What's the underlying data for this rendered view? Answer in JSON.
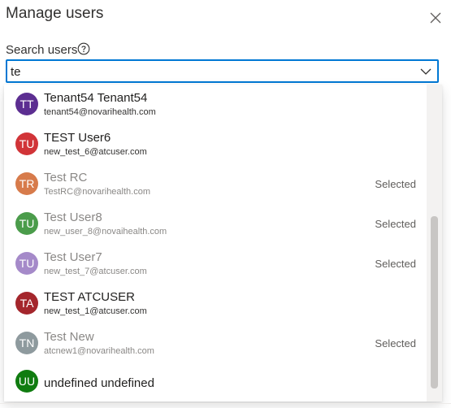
{
  "dialog": {
    "title": "Manage users",
    "close_icon": "close-icon"
  },
  "search": {
    "label": "Search users",
    "help_icon": "question-circle-icon",
    "value": "te",
    "dropdown_icon": "chevron-down-icon"
  },
  "options": [
    {
      "initials": "TT",
      "name": "Tenant54 Tenant54",
      "email": "tenant54@novarihealth.com",
      "color": "#5c2e91",
      "status": ""
    },
    {
      "initials": "TU",
      "name": "TEST User6",
      "email": "new_test_6@atcuser.com",
      "color": "#d13438",
      "status": ""
    },
    {
      "initials": "TR",
      "name": "Test RC",
      "email": "TestRC@novarihealth.com",
      "color": "#ca5010",
      "status": "Selected"
    },
    {
      "initials": "TU",
      "name": "Test User8",
      "email": "new_user_8@novaihealth.com",
      "color": "#107c10",
      "status": "Selected"
    },
    {
      "initials": "TU",
      "name": "Test User7",
      "email": "new_test_7@atcuser.com",
      "color": "#8764b8",
      "status": "Selected"
    },
    {
      "initials": "TA",
      "name": "TEST ATCUSER",
      "email": "new_test_1@atcuser.com",
      "color": "#a4262c",
      "status": ""
    },
    {
      "initials": "TN",
      "name": "Test New",
      "email": "atcnew1@novarihealth.com",
      "color": "#69797e",
      "status": "Selected"
    },
    {
      "initials": "UU",
      "name": "undefined undefined",
      "email": "",
      "color": "#107c10",
      "status": ""
    }
  ]
}
